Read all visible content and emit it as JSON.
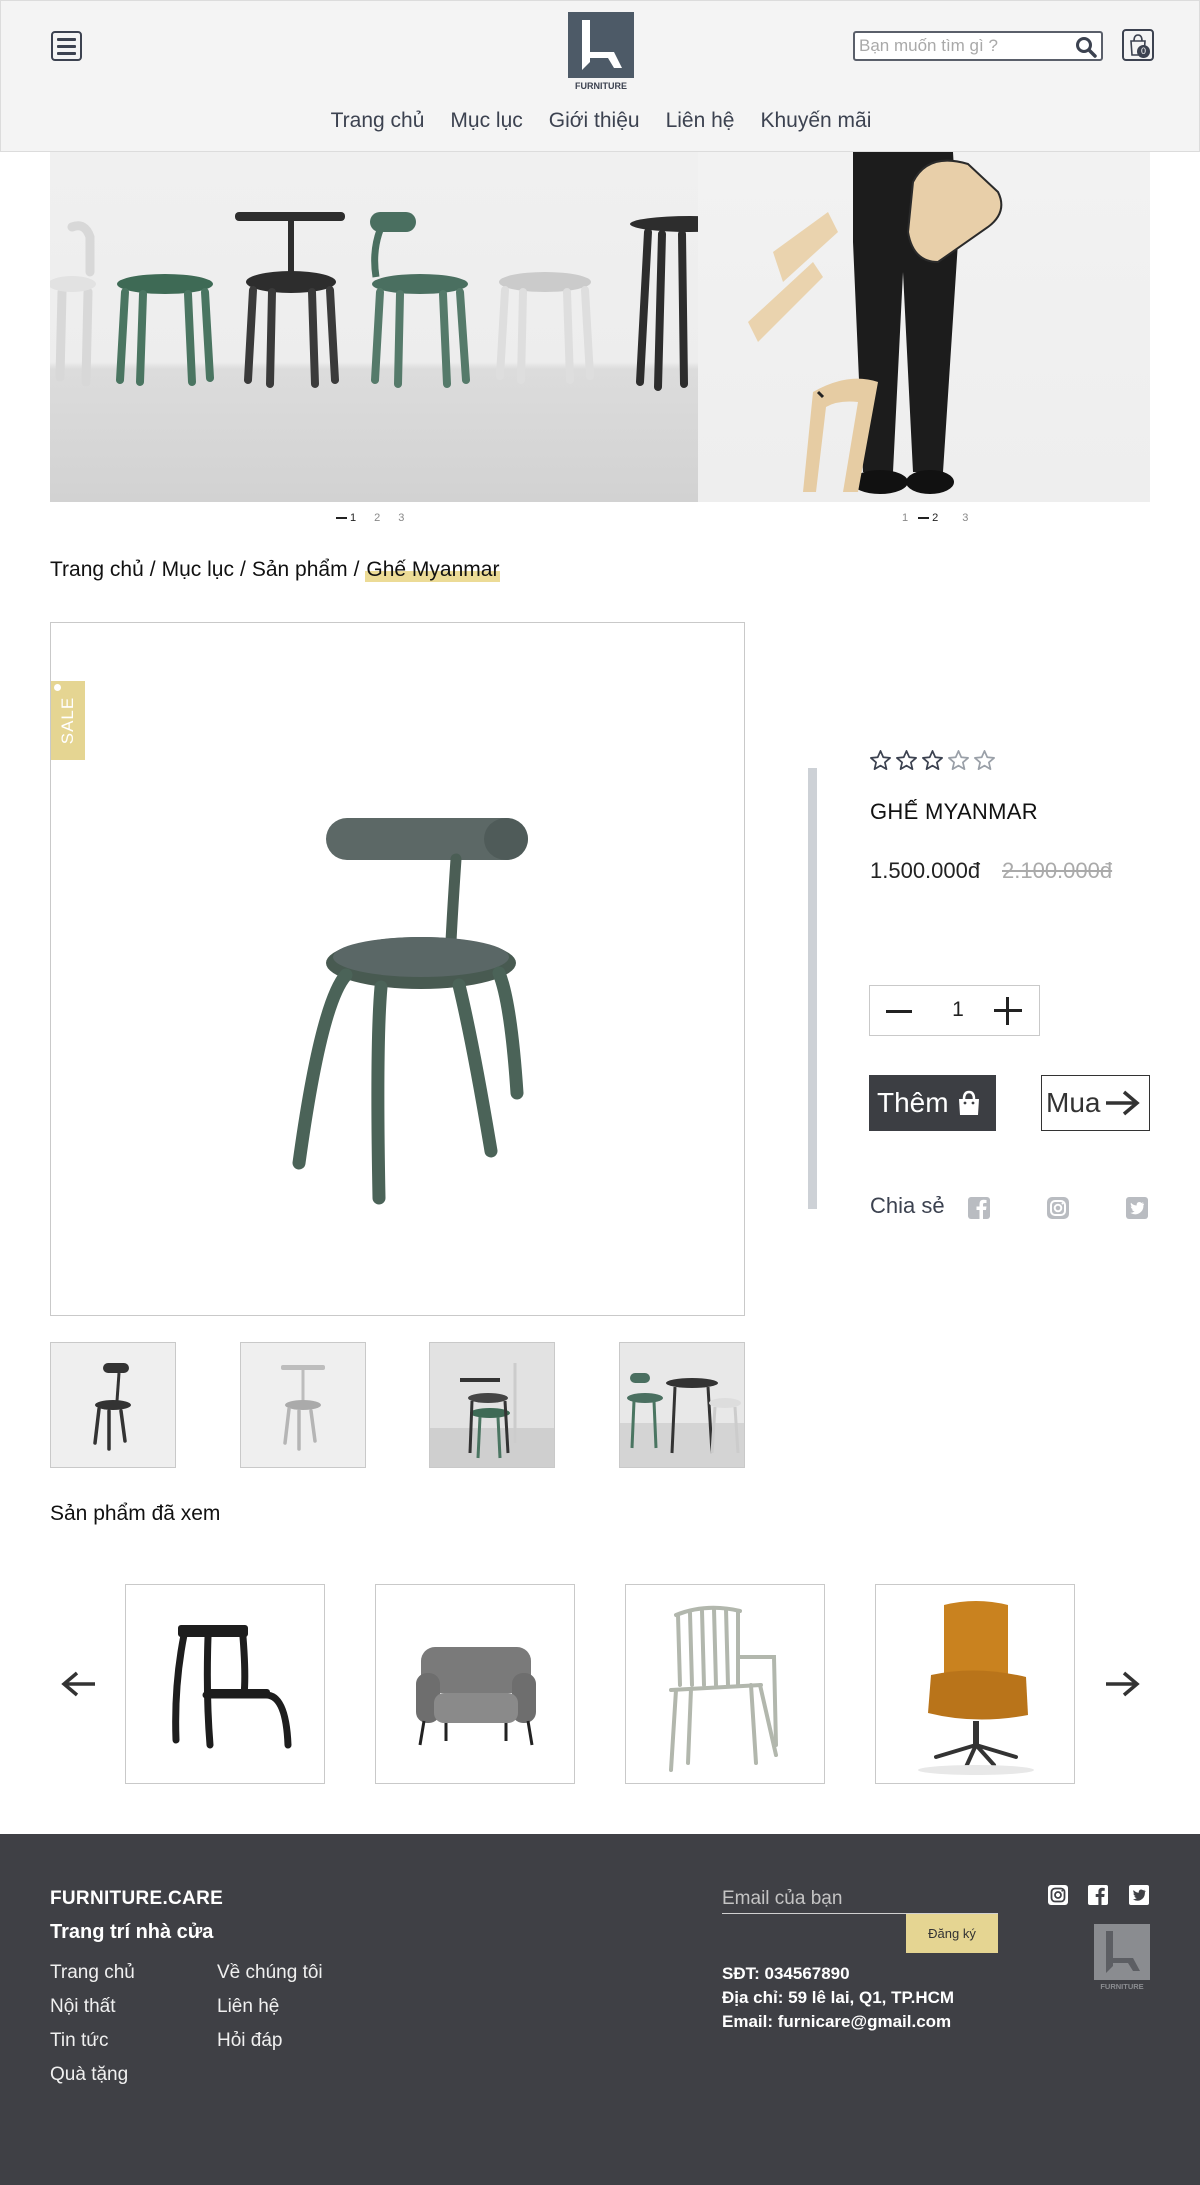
{
  "header": {
    "search_placeholder": "Bạn muốn tìm gì ?",
    "cart_count": "0",
    "logo_text": "FURNITURE",
    "nav": [
      "Trang chủ",
      "Mục lục",
      "Giới thiệu",
      "Liên hệ",
      "Khuyến mãi"
    ]
  },
  "banner": {
    "slider_left": {
      "dots": [
        "1",
        "2",
        "3"
      ],
      "active": "1"
    },
    "slider_right": {
      "dots": [
        "1",
        "2",
        "3"
      ],
      "active": "2"
    }
  },
  "breadcrumb": [
    "Trang chủ",
    "Mục lục",
    "Sản phẩm"
  ],
  "breadcrumb_current": "Ghế Myanmar",
  "breadcrumb_separator": "/",
  "product": {
    "sale_label": "SALE",
    "rating": 3,
    "rating_max": 5,
    "name": "GHẾ MYANMAR",
    "price": "1.500.000đ",
    "old_price": "2.100.000đ",
    "quantity": "1",
    "add_label": "Thêm",
    "buy_label": "Mua",
    "share_label": "Chia sẻ"
  },
  "viewed": {
    "title": "Sản phẩm đã xem"
  },
  "footer": {
    "brand": "FURNITURE.CARE",
    "slogan": "Trang trí nhà cửa",
    "links_col1": [
      "Trang chủ",
      "Nội thất",
      "Tin tức",
      "Quà tặng"
    ],
    "links_col2": [
      "Về chúng tôi",
      "Liên hệ",
      "Hỏi đáp"
    ],
    "email_placeholder": "Email của bạn",
    "subscribe_label": "Đăng ký",
    "phone": "SĐT: 034567890",
    "address": "Địa chỉ: 59 lê lai, Q1, TP.HCM",
    "email": "Email: furnicare@gmail.com",
    "logo_text": "FURNITURE"
  },
  "colors": {
    "accent": "#e5d592",
    "dark": "#3c3e43",
    "footer_bg": "#3f4045",
    "brand_gray": "#4d5a67"
  }
}
